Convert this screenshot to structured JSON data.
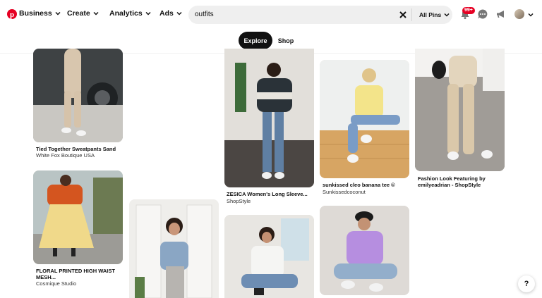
{
  "header": {
    "nav": [
      {
        "label": "Business",
        "icon": "chevron-down-icon"
      },
      {
        "label": "Create",
        "icon": "chevron-down-icon"
      },
      {
        "label": "Analytics",
        "icon": "chevron-down-icon"
      },
      {
        "label": "Ads",
        "icon": "chevron-down-icon"
      }
    ],
    "search": {
      "value": "outfits",
      "scope_label": "All Pins"
    },
    "notifications_badge": "99+",
    "icons": [
      "pinterest-logo-icon",
      "bell-icon",
      "chat-icon",
      "megaphone-icon",
      "avatar",
      "chevron-down-icon"
    ],
    "brand_color": "#e60023"
  },
  "tabs": [
    {
      "label": "Explore",
      "active": true
    },
    {
      "label": "Shop",
      "active": false
    }
  ],
  "pins": [
    {
      "title": "Tied Together Sweatpants Sand",
      "source": "White Fox Boutique USA"
    },
    {
      "title": "FLORAL PRINTED HIGH WAIST MESH...",
      "source": "Cosmique Studio"
    },
    {
      "title": "",
      "source": ""
    },
    {
      "title": "ZESICA Women's Long Sleeve...",
      "source": "ShopStyle"
    },
    {
      "title": "",
      "source": ""
    },
    {
      "title": "sunkissed cleo banana tee ©",
      "source": "Sunkissedcoconut"
    },
    {
      "title": "",
      "source": ""
    },
    {
      "title": "Fashion Look Featuring by emilyeadrian - ShopStyle",
      "source": ""
    }
  ],
  "help_label": "?"
}
